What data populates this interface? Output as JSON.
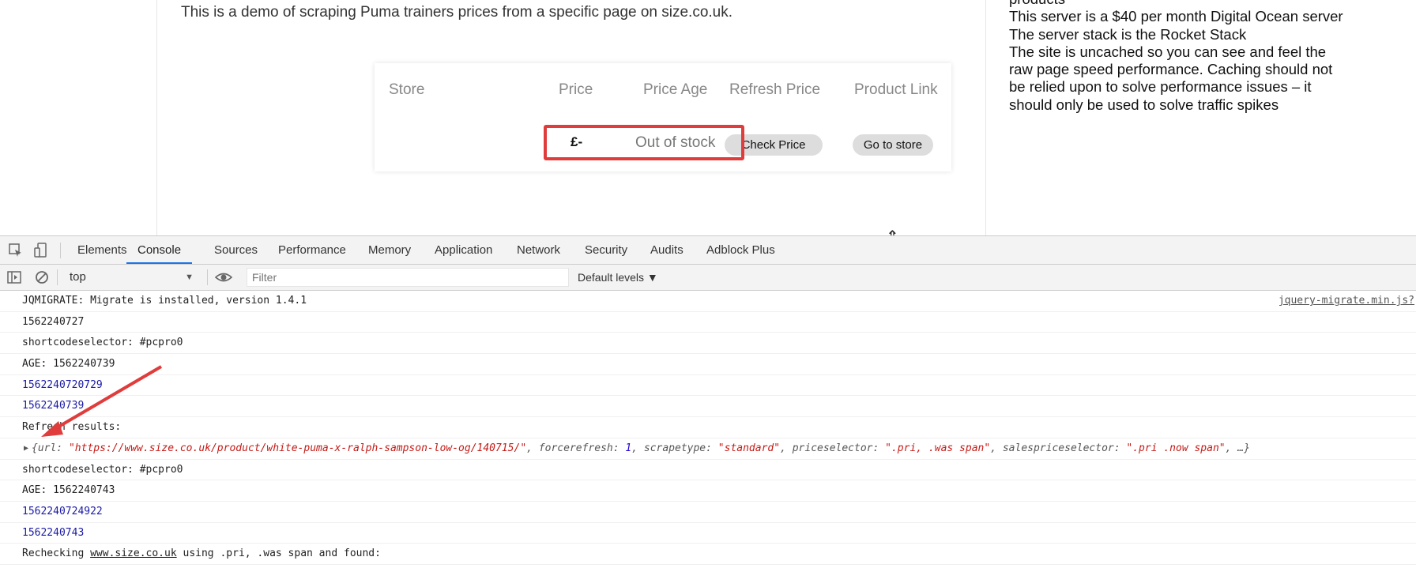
{
  "page": {
    "intro_text": "This is a demo of scraping Puma trainers prices from a specific page on size.co.uk.",
    "table": {
      "headers": [
        "Store",
        "Price",
        "Price Age",
        "Refresh Price",
        "Product Link"
      ],
      "row": {
        "store": "",
        "price": "£-",
        "price_age": "Out of stock",
        "refresh_button": "Check Price",
        "link_button": "Go to store"
      }
    },
    "sidebar_lines": [
      "products",
      "This server is a $40 per month Digital Ocean server",
      "The server stack is the Rocket Stack",
      "The site is uncached so you can see and feel the raw page speed performance. Caching should not be relied upon to solve performance issues – it should only be used to solve traffic spikes"
    ]
  },
  "devtools": {
    "tabs": [
      "Elements",
      "Console",
      "Sources",
      "Performance",
      "Memory",
      "Application",
      "Network",
      "Security",
      "Audits",
      "Adblock Plus"
    ],
    "active_tab": "Console",
    "context": "top",
    "filter_placeholder": "Filter",
    "levels": "Default levels ▼",
    "console": {
      "line0": {
        "text": "JQMIGRATE: Migrate is installed, version 1.4.1",
        "source": "jquery-migrate.min.js?"
      },
      "line1": "1562240727",
      "line2": "shortcodeselector: #pcpro0",
      "line3": "AGE: 1562240739",
      "line4": "1562240720729",
      "line5": "1562240739",
      "line6": "Refresh results:",
      "obj": {
        "open": "{url: ",
        "url_val": "\"https://www.size.co.uk/product/white-puma-x-ralph-sampson-low-og/140715/\"",
        "sep1": ", forcerefresh: ",
        "forcerefresh_val": "1",
        "sep2": ", scrapetype: ",
        "scrapetype_val": "\"standard\"",
        "sep3": ", priceselector: ",
        "priceselector_val": "\".pri, .was span\"",
        "sep4": ", salespriceselector: ",
        "salespriceselector_val": "\".pri .now span\"",
        "close": ", …}"
      },
      "line8": "shortcodeselector: #pcpro0",
      "line9": "AGE: 1562240743",
      "line10": "1562240724922",
      "line11": "1562240743",
      "line12": {
        "prefix": "Rechecking ",
        "link": "www.size.co.uk",
        "suffix": " using .pri, .was span and found:"
      }
    }
  },
  "colors": {
    "highlight_border": "#e03c3c",
    "active_tab_underline": "#1a73e8",
    "console_number_blue": "#1a1aa6",
    "string_red": "#c41a16"
  }
}
